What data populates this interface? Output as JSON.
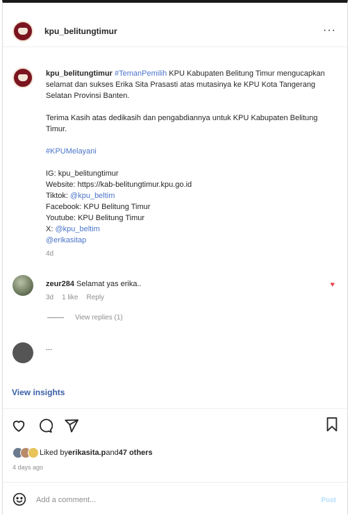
{
  "header": {
    "username": "kpu_belitungtimur",
    "more_label": "···"
  },
  "caption": {
    "username": "kpu_belitungtimur",
    "hashtag": "#TemanPemilih",
    "line1_rest": "KPU Kabupaten Belitung Timur mengucapkan selamat dan sukses Erika Sita Prasasti atas mutasinya ke KPU Kota Tangerang Selatan Provinsi Banten.",
    "para2": "Terima Kasih atas dedikasih dan pengabdiannya untuk KPU Kabupaten Belitung Timur.",
    "hashtag2": "#KPUMelayani",
    "ig": "IG: kpu_belitungtimur",
    "website": "Website: https://kab-belitungtimur.kpu.go.id",
    "tiktok_label": "Tiktok: ",
    "tiktok_handle": "@kpu_beltim",
    "facebook": "Facebook: KPU Belitung Timur",
    "youtube": "Youtube: KPU Belitung Timur",
    "x_label": "X: ",
    "x_handle": "@kpu_beltim",
    "mention": "@erikasitap",
    "time": "4d"
  },
  "comment1": {
    "username": "zeur284",
    "text": "Selamat yas erika..",
    "time": "3d",
    "likes": "1 like",
    "reply": "Reply",
    "view_replies": "View replies (1)"
  },
  "comment2": {
    "text": "..."
  },
  "insights": {
    "label": "View insights"
  },
  "likes": {
    "prefix": "Liked by ",
    "user": "erikasita.p",
    "mid": " and ",
    "others": "47 others"
  },
  "timeago": "4 days ago",
  "add_comment": {
    "placeholder": "Add a comment...",
    "post_label": "Post"
  }
}
